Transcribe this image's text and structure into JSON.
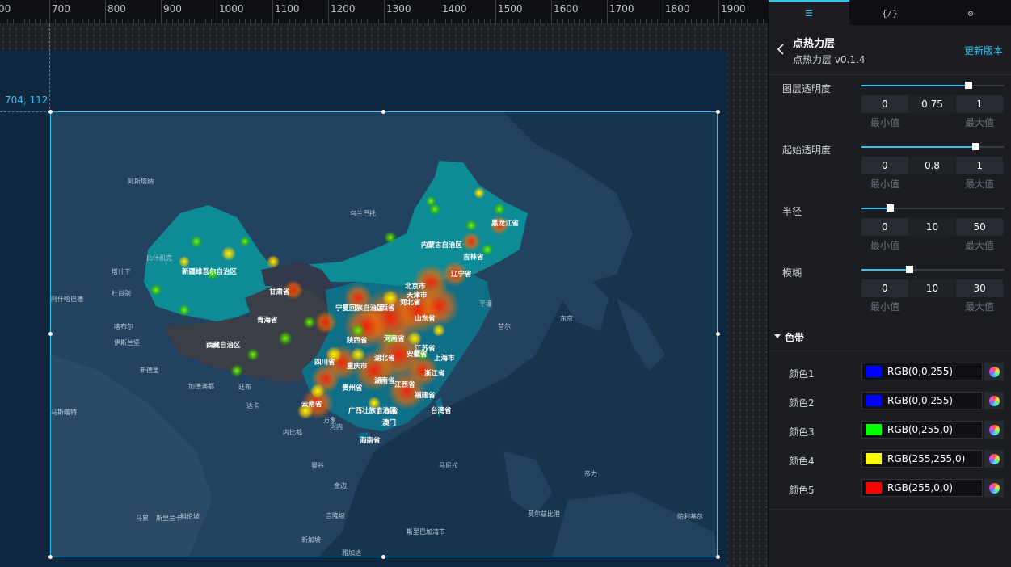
{
  "ruler": {
    "ticks": [
      "00",
      "700",
      "800",
      "900",
      "1000",
      "1100",
      "1200",
      "1300",
      "1400",
      "1500",
      "1600",
      "1700",
      "1800",
      "1900"
    ]
  },
  "canvas": {
    "coord_label": "704, 112"
  },
  "map": {
    "country_labels": [
      "阿斯塔纳",
      "乌兰巴托",
      "比什凯克",
      "塔什干",
      "杜尚别",
      "阿什哈巴德",
      "喀布尔",
      "伊斯兰堡",
      "新德里",
      "加德满都",
      "廷布",
      "达卡",
      "内比都",
      "马斯喀特",
      "万象",
      "曼谷",
      "金边",
      "河内",
      "马尼拉",
      "首尔",
      "平壤",
      "东京",
      "斯里兰卡",
      "马累",
      "科伦坡",
      "吉隆坡",
      "新加坡",
      "斯里巴加湾市",
      "雅加达",
      "帝力",
      "莫尔兹比港",
      "帕利基尔"
    ],
    "province_labels": [
      "新疆维吾尔自治区",
      "西藏自治区",
      "青海省",
      "甘肃省",
      "内蒙古自治区",
      "黑龙江省",
      "吉林省",
      "辽宁省",
      "北京市",
      "天津市",
      "河北省",
      "山西省",
      "山东省",
      "宁夏回族自治区",
      "陕西省",
      "河南省",
      "江苏省",
      "安徽省",
      "上海市",
      "湖北省",
      "四川省",
      "重庆市",
      "浙江省",
      "湖南省",
      "江西省",
      "贵州省",
      "福建省",
      "云南省",
      "广西壮族自治区",
      "广东省",
      "台湾省",
      "海南省",
      "澳门"
    ]
  },
  "panel": {
    "tabs": [
      "☰",
      "{/}",
      "⚙"
    ],
    "title": "点热力层",
    "version": "点热力层 v0.1.4",
    "update_label": "更新版本",
    "props": [
      {
        "label": "图层透明度",
        "min": "0",
        "value": "0.75",
        "max": "1",
        "fraction": 0.75
      },
      {
        "label": "起始透明度",
        "min": "0",
        "value": "0.8",
        "max": "1",
        "fraction": 0.8
      },
      {
        "label": "半径",
        "min": "0",
        "value": "10",
        "max": "50",
        "fraction": 0.2
      },
      {
        "label": "模糊",
        "min": "0",
        "value": "10",
        "max": "30",
        "fraction": 0.333
      }
    ],
    "min_caption": "最小值",
    "max_caption": "最大值",
    "colorband_title": "色带",
    "colors": [
      {
        "label": "颜色1",
        "value": "RGB(0,0,255)",
        "hex": "#0000ff"
      },
      {
        "label": "颜色2",
        "value": "RGB(0,0,255)",
        "hex": "#0000ff"
      },
      {
        "label": "颜色3",
        "value": "RGB(0,255,0)",
        "hex": "#00ff00"
      },
      {
        "label": "颜色4",
        "value": "RGB(255,255,0)",
        "hex": "#ffff00"
      },
      {
        "label": "颜色5",
        "value": "RGB(255,0,0)",
        "hex": "#ff0000"
      }
    ]
  }
}
